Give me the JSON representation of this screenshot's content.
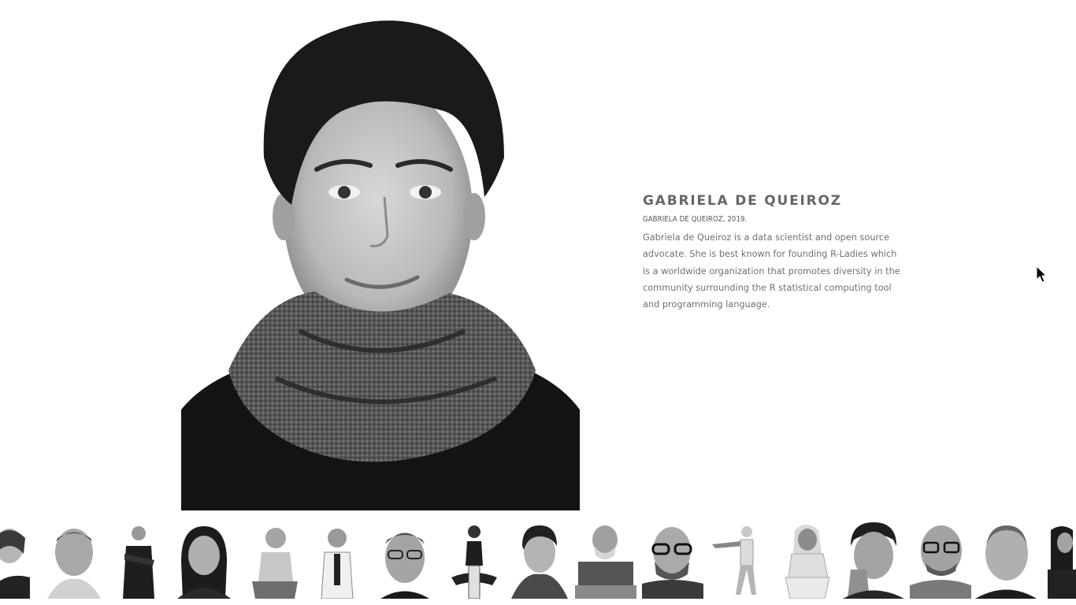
{
  "featured": {
    "name": "GABRIELA DE QUEIROZ",
    "caption": "GABRIELA DE QUEIROZ, 2019.",
    "bio": "Gabriela de Queiroz is a data scientist and open source advocate. She is best known for founding R-Ladies which is a worldwide organization that promotes diversity in the community surrounding the R statistical computing tool and programming language.",
    "photo_icon": "portrait-photo-bw"
  },
  "thumbnails": [
    {
      "id": "t1",
      "style": "closeup-woman"
    },
    {
      "id": "t2",
      "style": "closeup-man-grey"
    },
    {
      "id": "t3",
      "style": "standing-man-dark"
    },
    {
      "id": "t4",
      "style": "closeup-woman-dark-hair"
    },
    {
      "id": "t5",
      "style": "seated-man"
    },
    {
      "id": "t6",
      "style": "standing-woman-blazer"
    },
    {
      "id": "t7",
      "style": "closeup-man-glasses"
    },
    {
      "id": "t8",
      "style": "seated-woman-chair"
    },
    {
      "id": "t9",
      "style": "closeup-woman-scarf"
    },
    {
      "id": "t10",
      "style": "man-beard-patterned-shirt"
    },
    {
      "id": "t11",
      "style": "man-glasses-beard"
    },
    {
      "id": "t12",
      "style": "dancing-woman"
    },
    {
      "id": "t13",
      "style": "seated-woman-stool"
    },
    {
      "id": "t14",
      "style": "man-hand-chin"
    },
    {
      "id": "t15",
      "style": "man-glasses-shirt"
    },
    {
      "id": "t16",
      "style": "man-bald"
    },
    {
      "id": "t17",
      "style": "partial-woman"
    }
  ],
  "colors": {
    "text_heading": "#666666",
    "text_body": "#707070",
    "background": "#ffffff"
  }
}
